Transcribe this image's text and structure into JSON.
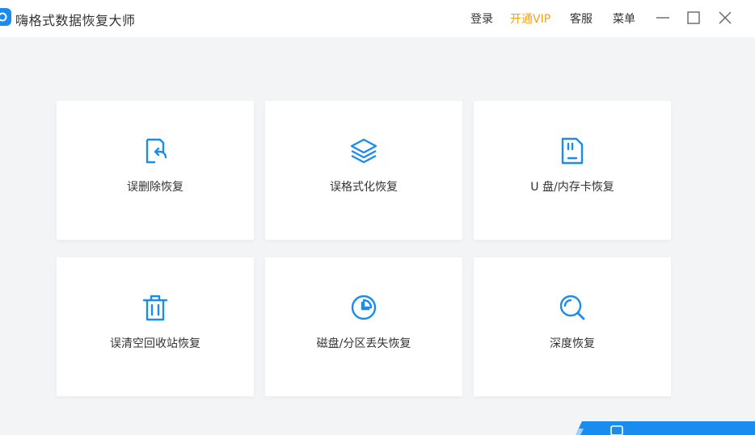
{
  "app": {
    "title": "嗨格式数据恢复大师",
    "accent_color": "#1a8cf0",
    "vip_color": "#f0a31c"
  },
  "header": {
    "login": "登录",
    "vip": "开通VIP",
    "service": "客服",
    "menu": "菜单",
    "minimize_icon": "minimize-icon",
    "maximize_icon": "maximize-icon",
    "close_icon": "close-icon"
  },
  "cards": [
    {
      "label": "误删除恢复",
      "icon": "file-restore-icon"
    },
    {
      "label": "误格式化恢复",
      "icon": "layers-icon"
    },
    {
      "label": "U 盘/内存卡恢复",
      "icon": "sd-card-icon"
    },
    {
      "label": "误清空回收站恢复",
      "icon": "trash-icon"
    },
    {
      "label": "磁盘/分区丢失恢复",
      "icon": "pie-chart-icon"
    },
    {
      "label": "深度恢复",
      "icon": "search-icon"
    }
  ]
}
